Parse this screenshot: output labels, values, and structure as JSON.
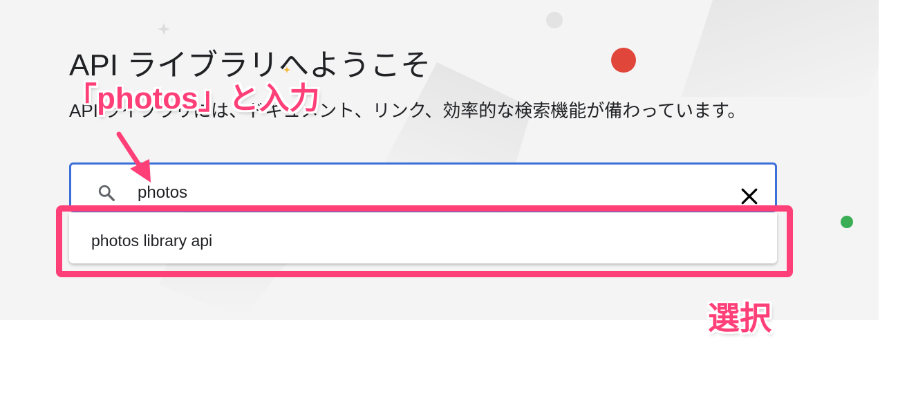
{
  "page": {
    "title": "API ライブラリへようこそ",
    "subtitle": "API ライブラリには、ドキュメント、リンク、効率的な検索機能が備わっています。"
  },
  "search": {
    "value": "photos",
    "placeholder": ""
  },
  "suggestions": [
    {
      "label": "photos library api"
    }
  ],
  "annotations": {
    "input_callout": "「photos」と入力",
    "select_callout": "選択"
  },
  "colors": {
    "accent_blue": "#3b6fd9",
    "annotation_pink": "#ff3f78",
    "dot_red": "#e0463a",
    "dot_green": "#3bae55"
  },
  "icons": {
    "search": "search-icon",
    "clear": "close-icon"
  }
}
